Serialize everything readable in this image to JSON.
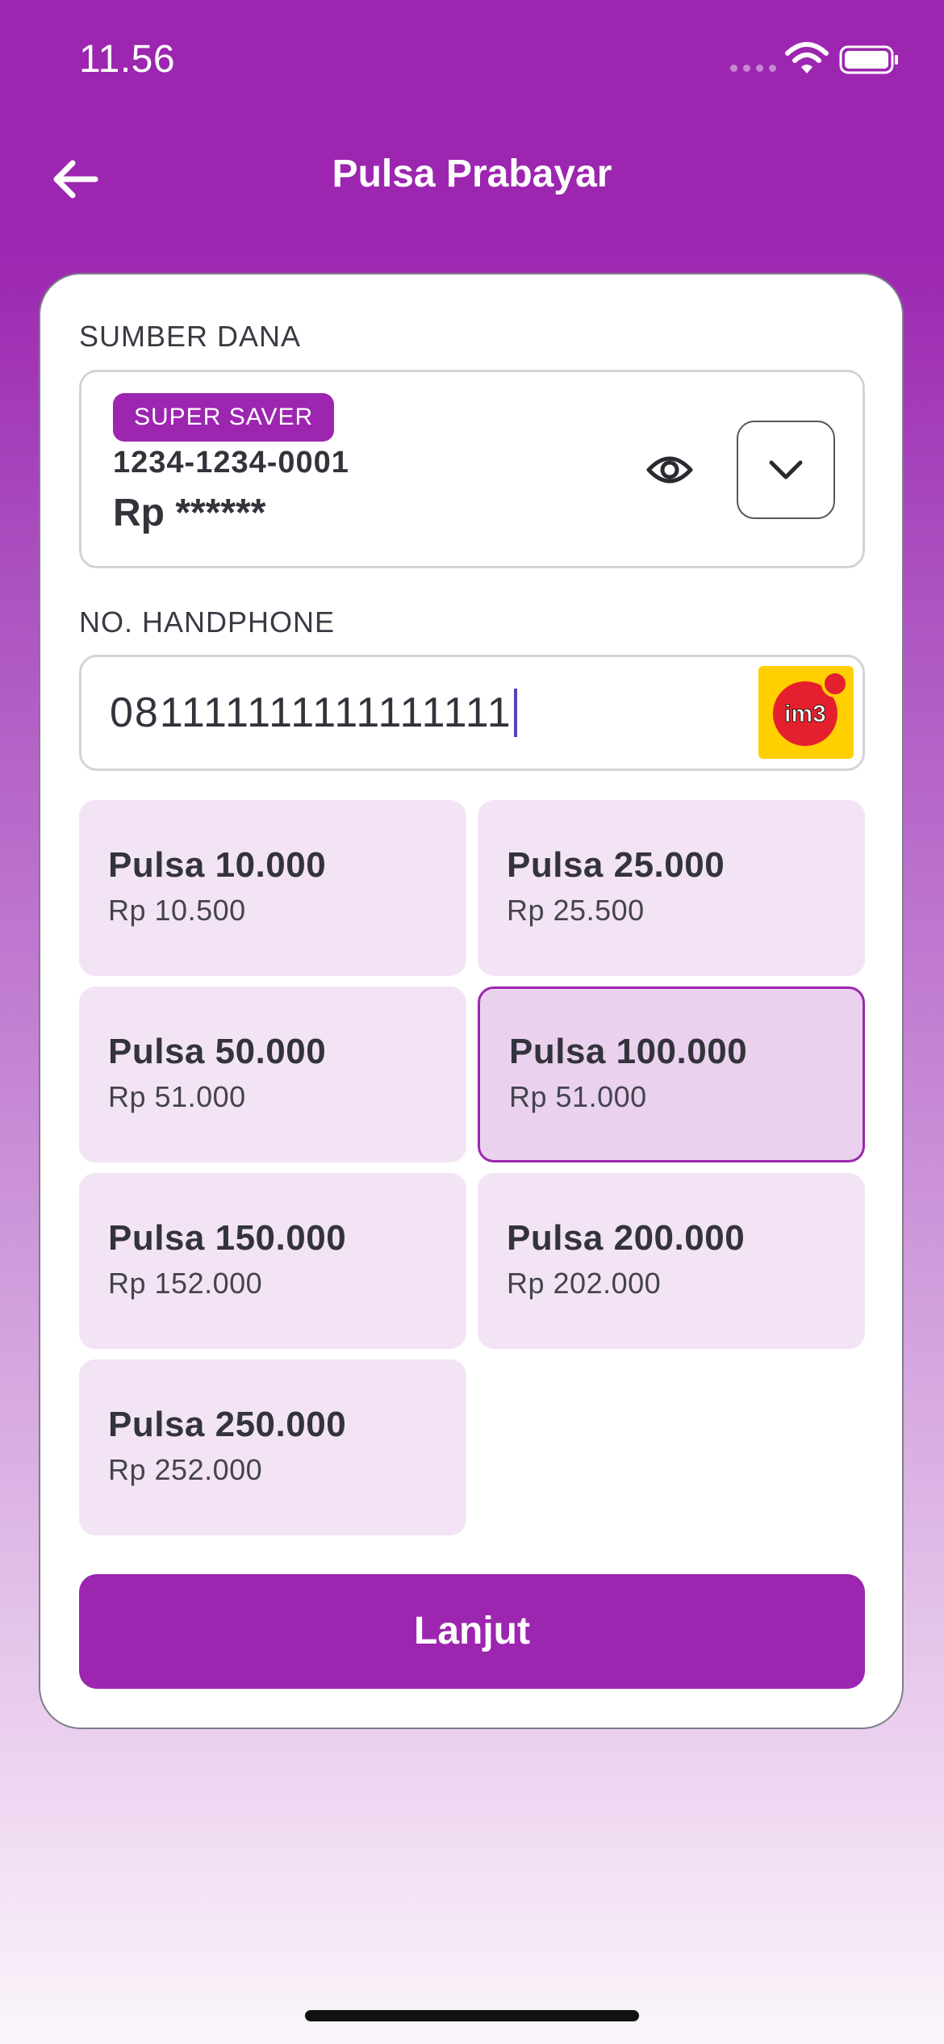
{
  "status_bar": {
    "time": "11.56"
  },
  "header": {
    "title": "Pulsa Prabayar",
    "back_icon": "arrow-left-icon"
  },
  "funding": {
    "label": "SUMBER DANA",
    "badge": "SUPER SAVER",
    "account_number": "1234-1234-0001",
    "balance": "Rp ******",
    "eye_icon": "eye-icon",
    "dropdown_icon": "chevron-down-icon"
  },
  "phone": {
    "label": "NO. HANDPHONE",
    "value": "081111111111111111",
    "operator_logo_text": "im3"
  },
  "options": [
    {
      "title": "Pulsa 10.000",
      "price": "Rp 10.500",
      "selected": false
    },
    {
      "title": "Pulsa 25.000",
      "price": "Rp 25.500",
      "selected": false
    },
    {
      "title": "Pulsa 50.000",
      "price": "Rp 51.000",
      "selected": false
    },
    {
      "title": "Pulsa 100.000",
      "price": "Rp 51.000",
      "selected": true
    },
    {
      "title": "Pulsa 150.000",
      "price": "Rp 152.000",
      "selected": false
    },
    {
      "title": "Pulsa 200.000",
      "price": "Rp 202.000",
      "selected": false
    },
    {
      "title": "Pulsa 250.000",
      "price": "Rp 252.000",
      "selected": false
    }
  ],
  "actions": {
    "continue_label": "Lanjut"
  },
  "colors": {
    "primary": "#9c26b0",
    "option_bg": "#f3e4f5",
    "option_selected_bg": "#ead2ee",
    "operator_logo_bg": "#ffcf00",
    "operator_logo_red": "#e5202e"
  }
}
